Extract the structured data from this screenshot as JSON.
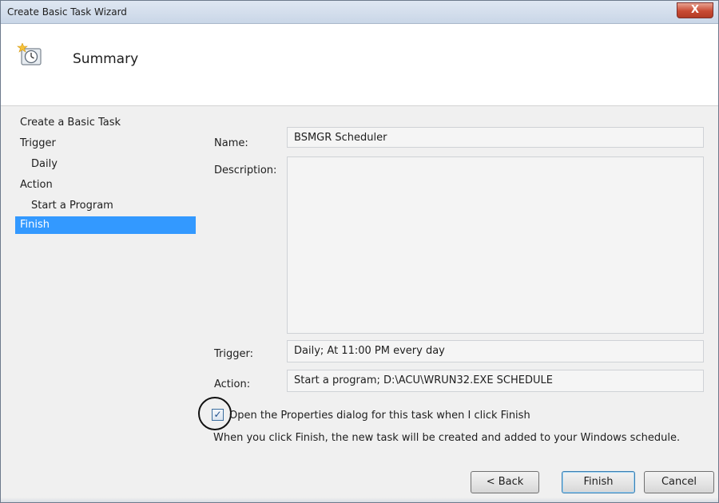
{
  "window": {
    "title": "Create Basic Task Wizard",
    "close_glyph": "X"
  },
  "header": {
    "title": "Summary",
    "icon": "scheduled-task-clock-icon"
  },
  "steps": [
    {
      "label": "Create a Basic Task"
    },
    {
      "label": "Trigger"
    },
    {
      "label": "Daily"
    },
    {
      "label": "Action"
    },
    {
      "label": "Start a Program"
    },
    {
      "label": "Finish"
    }
  ],
  "summary": {
    "name_label": "Name:",
    "name_value": "BSMGR Scheduler",
    "description_label": "Description:",
    "description_value": "",
    "trigger_label": "Trigger:",
    "trigger_value": "Daily; At 11:00 PM every day",
    "action_label": "Action:",
    "action_value": "Start a program; D:\\ACU\\WRUN32.EXE SCHEDULE"
  },
  "open_properties": {
    "checked": true,
    "label": "Open the Properties dialog for this task when I click Finish"
  },
  "info_text": "When you click Finish, the new task will be created and added to your Windows schedule.",
  "buttons": {
    "back": "< Back",
    "finish": "Finish",
    "cancel": "Cancel"
  },
  "colors": {
    "selection": "#3399ff",
    "close": "#c84a33"
  }
}
